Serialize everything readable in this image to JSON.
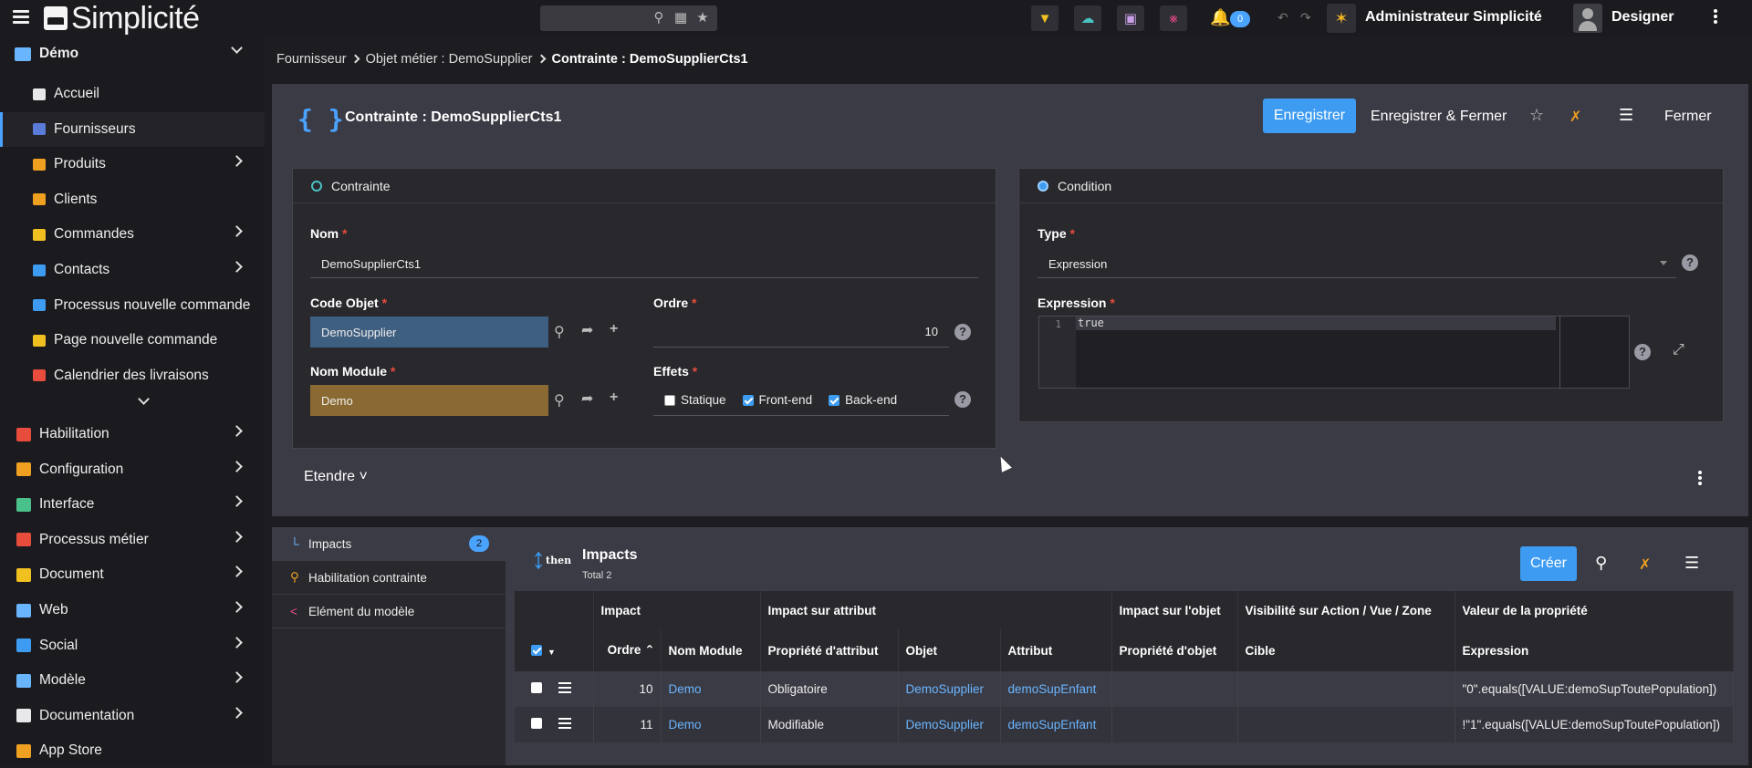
{
  "topbar": {
    "app_name": "Simplicité",
    "notifications_count": "0",
    "user_name": "Administrateur Simplicité",
    "mode_label": "Designer"
  },
  "sidebar": {
    "section": "Démo",
    "items": [
      {
        "label": "Accueil",
        "icon": "home-icon",
        "color": "#e8e8ea",
        "has_children": false
      },
      {
        "label": "Fournisseurs",
        "icon": "supplier-icon",
        "color": "#5b7bd8",
        "has_children": false,
        "active": true
      },
      {
        "label": "Produits",
        "icon": "product-icon",
        "color": "#f0a020",
        "has_children": true
      },
      {
        "label": "Clients",
        "icon": "clients-icon",
        "color": "#f0a020",
        "has_children": false
      },
      {
        "label": "Commandes",
        "icon": "folder-icon",
        "color": "#f0c020",
        "has_children": true
      },
      {
        "label": "Contacts",
        "icon": "contacts-icon",
        "color": "#3d9cf2",
        "has_children": true
      },
      {
        "label": "Processus nouvelle commande",
        "icon": "play-icon",
        "color": "#3d9cf2",
        "has_children": false
      },
      {
        "label": "Page nouvelle commande",
        "icon": "page-icon",
        "color": "#f0c020",
        "has_children": false
      },
      {
        "label": "Calendrier des livraisons",
        "icon": "calendar-icon",
        "color": "#e74c3c",
        "has_children": false
      }
    ],
    "groups": [
      {
        "label": "Habilitation",
        "icon": "user-icon",
        "color": "#e74c3c"
      },
      {
        "label": "Configuration",
        "icon": "tools-icon",
        "color": "#f0a020"
      },
      {
        "label": "Interface",
        "icon": "interface-icon",
        "color": "#4ac18a"
      },
      {
        "label": "Processus métier",
        "icon": "process-icon",
        "color": "#e74c3c"
      },
      {
        "label": "Document",
        "icon": "document-icon",
        "color": "#f0c020"
      },
      {
        "label": "Web",
        "icon": "web-icon",
        "color": "#6ab5ff"
      },
      {
        "label": "Social",
        "icon": "social-icon",
        "color": "#3d9cf2"
      },
      {
        "label": "Modèle",
        "icon": "model-icon",
        "color": "#6ab5ff"
      },
      {
        "label": "Documentation",
        "icon": "markdown-icon",
        "color": "#e8e8ea"
      },
      {
        "label": "App Store",
        "icon": "store-icon",
        "color": "#f0a020"
      }
    ]
  },
  "breadcrumb": {
    "items": [
      "Fournisseur",
      "Objet métier : DemoSupplier",
      "Contrainte : DemoSupplierCts1"
    ]
  },
  "form": {
    "title": "Contrainte : DemoSupplierCts1",
    "actions": {
      "save": "Enregistrer",
      "save_close": "Enregistrer & Fermer",
      "close": "Fermer"
    },
    "card_constraint": {
      "title": "Contrainte",
      "name_label": "Nom",
      "name_value": "DemoSupplierCts1",
      "object_label": "Code Objet",
      "object_value": "DemoSupplier",
      "order_label": "Ordre",
      "order_value": "10",
      "module_label": "Nom Module",
      "module_value": "Demo",
      "effects_label": "Effets",
      "effect_static": "Statique",
      "effect_front": "Front-end",
      "effect_back": "Back-end"
    },
    "card_condition": {
      "title": "Condition",
      "type_label": "Type",
      "type_value": "Expression",
      "expr_label": "Expression",
      "line_no": "1",
      "code": "true"
    },
    "expand_label": "Etendre"
  },
  "tabs": [
    {
      "label": "Impacts",
      "count": "2"
    },
    {
      "label": "Habilitation contrainte"
    },
    {
      "label": "Elément du modèle"
    }
  ],
  "impacts": {
    "title": "Impacts",
    "total": "Total 2",
    "create": "Créer",
    "then_label": "then",
    "group_headers": [
      "Impact",
      "Impact sur attribut",
      "Impact sur l'objet",
      "Visibilité sur Action / Vue / Zone",
      "Valeur de la propriété"
    ],
    "columns": [
      "Ordre",
      "Nom Module",
      "Propriété d'attribut",
      "Objet",
      "Attribut",
      "Propriété d'objet",
      "Cible",
      "Expression"
    ],
    "rows": [
      {
        "order": "10",
        "module": "Demo",
        "prop": "Obligatoire",
        "object": "DemoSupplier",
        "attribute": "demoSupEnfant",
        "obj_prop": "",
        "target": "",
        "expr": "\"0\".equals([VALUE:demoSupToutePopulation])"
      },
      {
        "order": "11",
        "module": "Demo",
        "prop": "Modifiable",
        "object": "DemoSupplier",
        "attribute": "demoSupEnfant",
        "obj_prop": "",
        "target": "",
        "expr": "!\"1\".equals([VALUE:demoSupToutePopulation])"
      }
    ]
  }
}
